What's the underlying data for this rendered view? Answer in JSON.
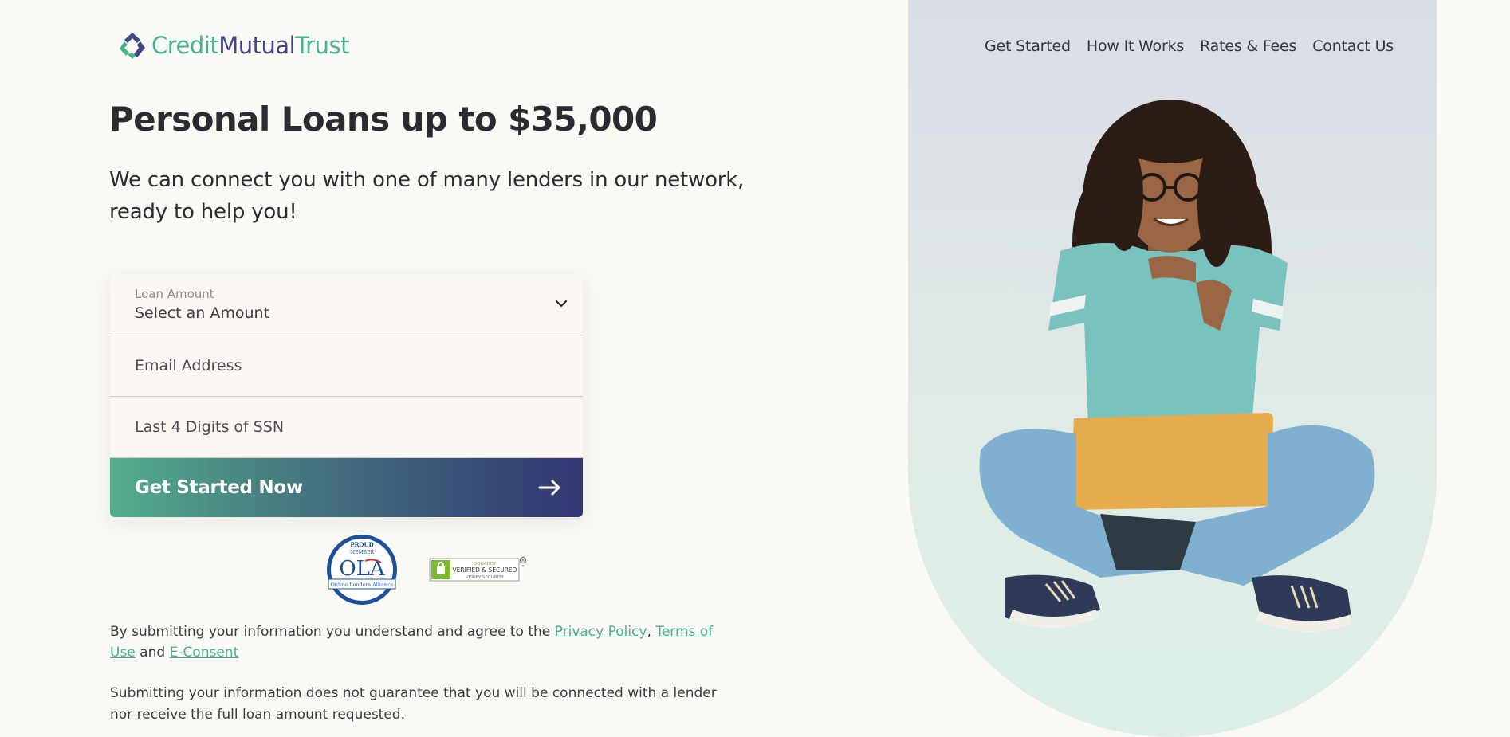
{
  "brand": {
    "logo_part1": "Credit",
    "logo_part2": "Mutual",
    "logo_part3": "Trust",
    "colors": {
      "green": "#49b28d",
      "navy": "#3e4787",
      "cta_start": "#53ad8c",
      "cta_end": "#323673"
    }
  },
  "nav": {
    "items": [
      {
        "label": "Get Started"
      },
      {
        "label": "How It Works"
      },
      {
        "label": "Rates & Fees"
      },
      {
        "label": "Contact Us"
      }
    ]
  },
  "hero": {
    "title": "Personal Loans up to $35,000",
    "subtitle": "We can connect you with one of many lenders in our network, ready to help you!"
  },
  "form": {
    "loan_amount_label": "Loan Amount",
    "loan_amount_value": "Select an Amount",
    "email_placeholder": "Email Address",
    "ssn_placeholder": "Last 4 Digits of SSN",
    "submit_label": "Get Started Now",
    "icons": {
      "dropdown": "chevron-down-icon",
      "submit": "arrow-right-icon"
    }
  },
  "badges": {
    "ola_top": "PROUD",
    "ola_mid": "MEMBER",
    "ola_main": "OLA",
    "ola_bottom": "Online Lenders Alliance",
    "godaddy_top": "GODADDY",
    "godaddy_main": "VERIFIED & SECURED",
    "godaddy_bottom": "VERIFY SECURITY"
  },
  "disclaimer": {
    "intro": "By submitting your information you understand and agree to the ",
    "privacy": "Privacy Policy",
    "comma": ", ",
    "terms": "Terms of Use",
    "and": " and ",
    "econsent": "E-Consent",
    "note": "Submitting your information does not guarantee that you will be connected with a lender nor receive the full loan amount requested."
  }
}
